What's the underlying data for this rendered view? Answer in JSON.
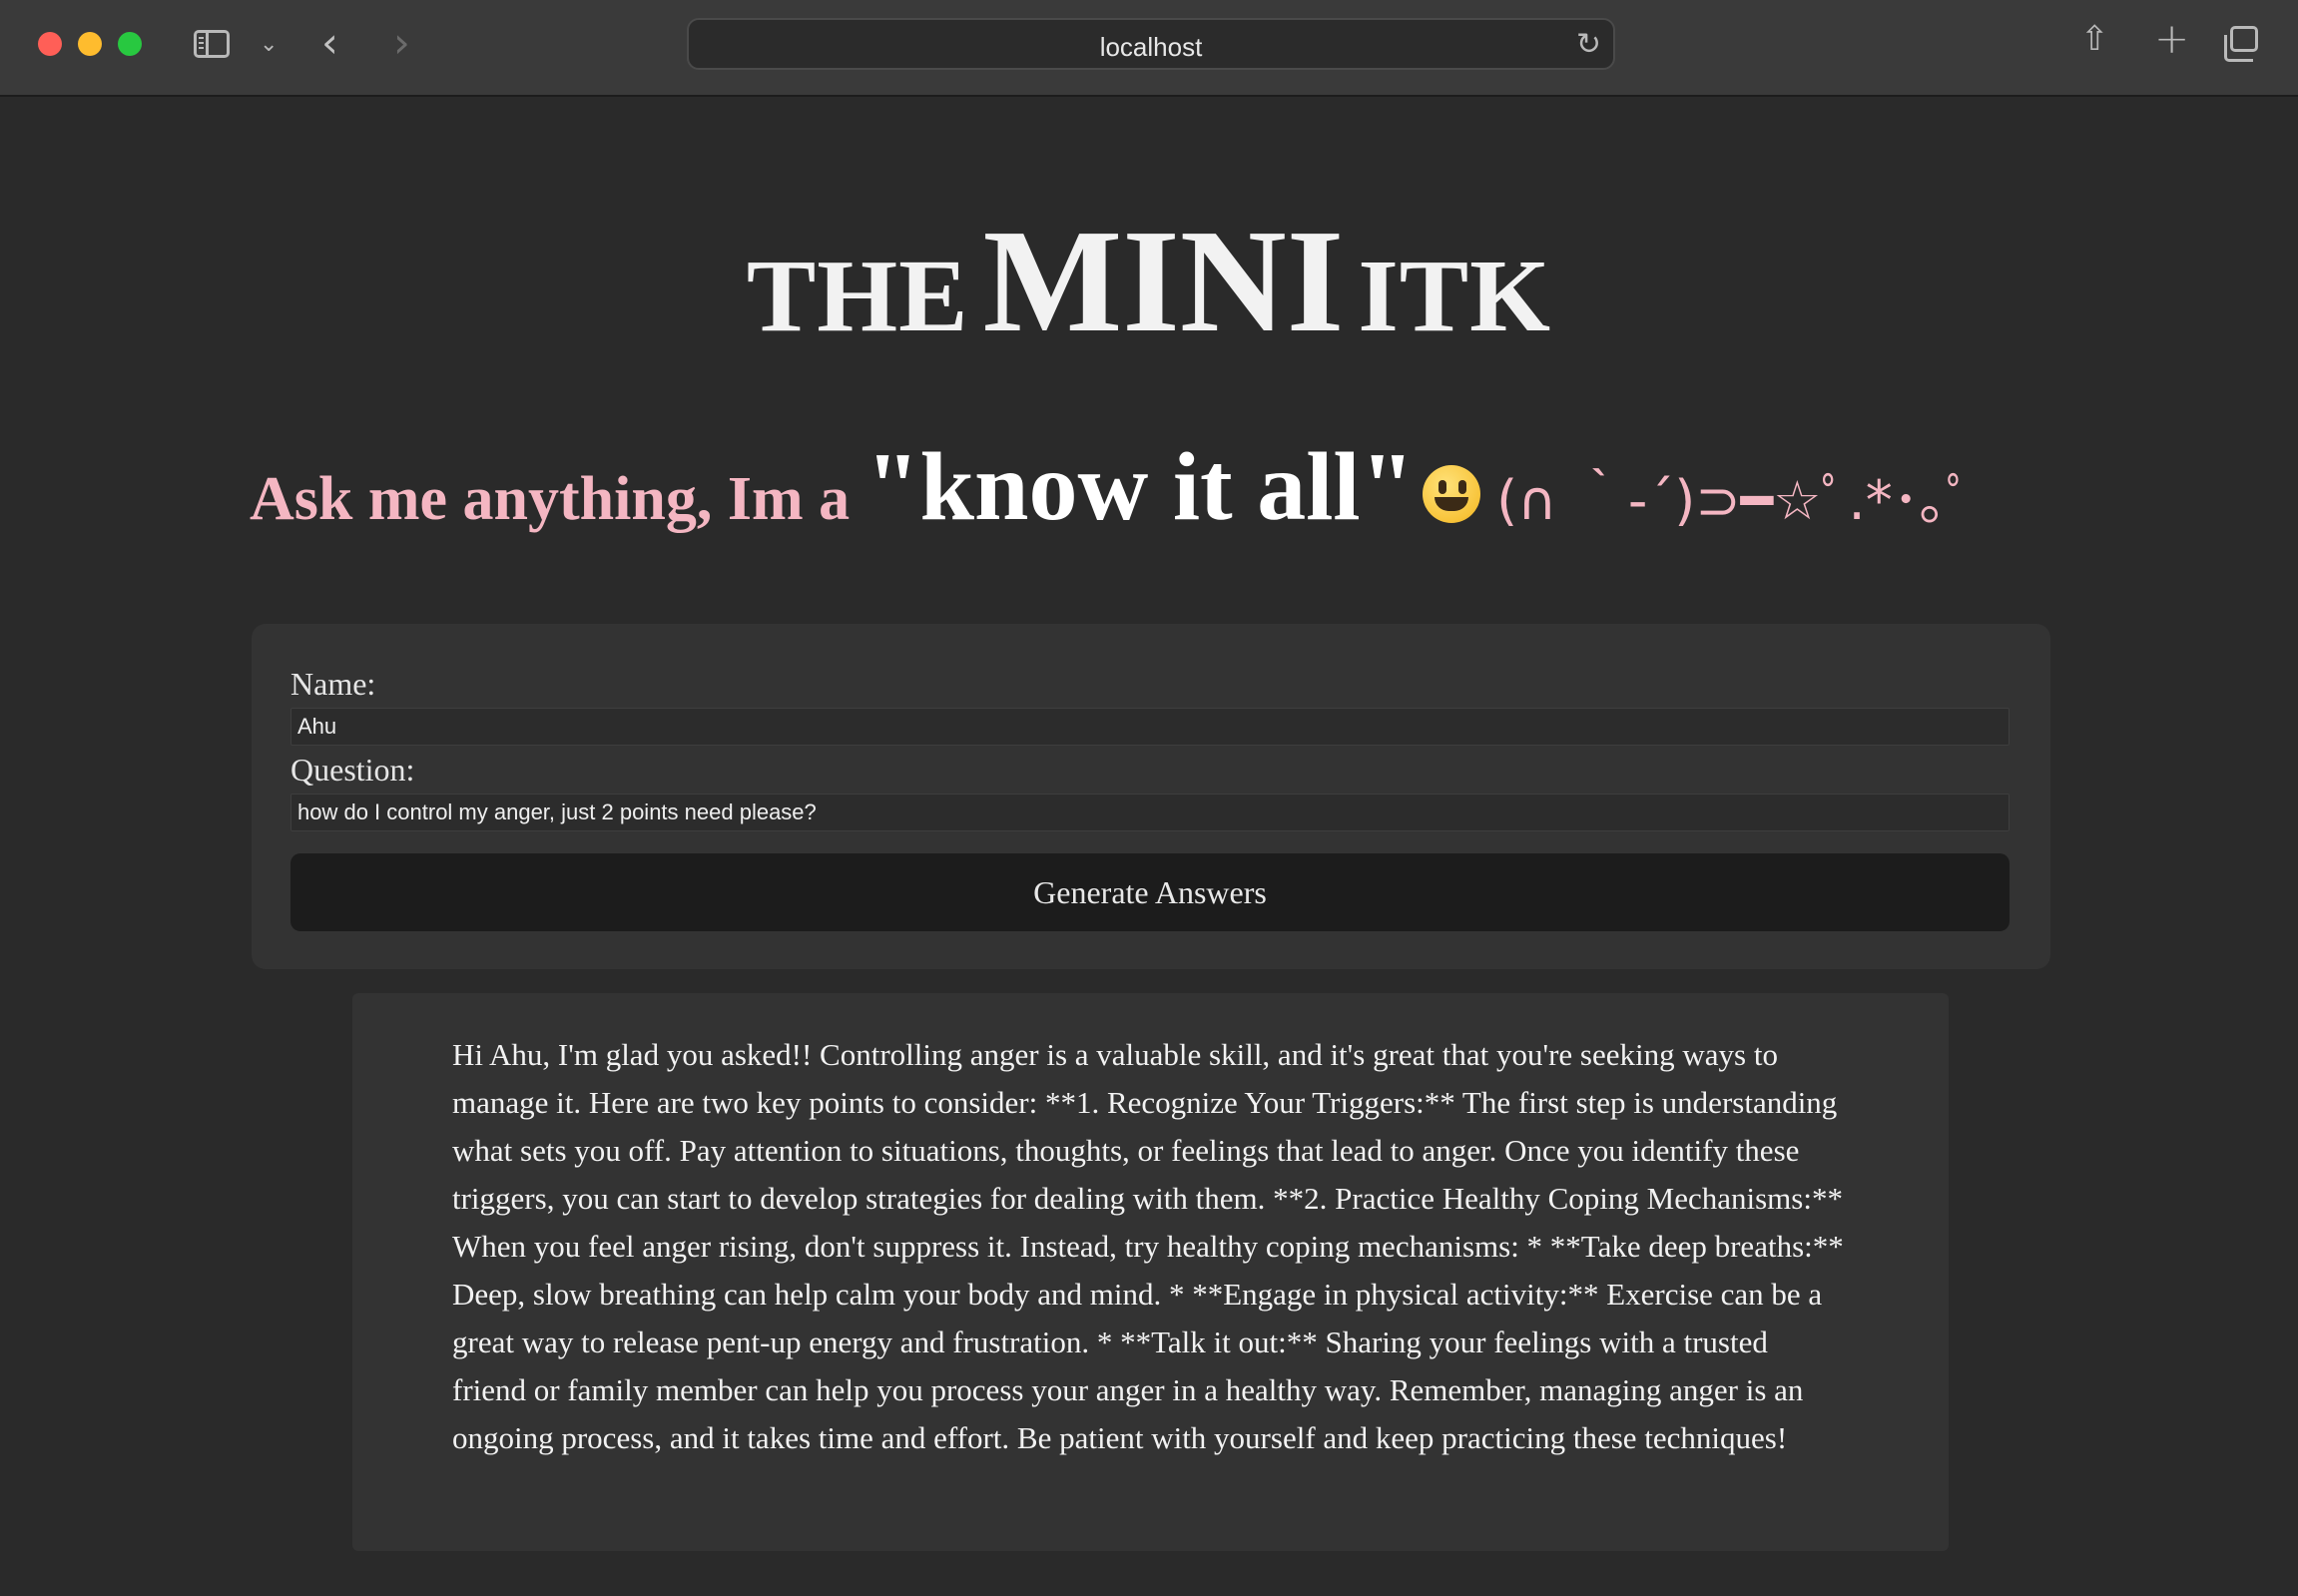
{
  "browser": {
    "url": "localhost"
  },
  "hero": {
    "title_pre": "THE",
    "title_main": "MINI",
    "title_post": "ITK"
  },
  "subtitle": {
    "lead": "Ask me anything, Im a",
    "quote": "\"know it all\"",
    "emoji_icon": "smiley-face-icon",
    "kaomoji": "(∩ ｀-´)⊃━☆ﾟ.*･｡ﾟ"
  },
  "form": {
    "name_label": "Name:",
    "name_value": "Ahu",
    "question_label": "Question:",
    "question_value": "how do I control my anger, just 2 points need please?",
    "submit_label": "Generate Answers"
  },
  "answer": {
    "text": "Hi Ahu, I'm glad you asked!! Controlling anger is a valuable skill, and it's great that you're seeking ways to manage it. Here are two key points to consider: **1. Recognize Your Triggers:** The first step is understanding what sets you off. Pay attention to situations, thoughts, or feelings that lead to anger. Once you identify these triggers, you can start to develop strategies for dealing with them. **2. Practice Healthy Coping Mechanisms:** When you feel anger rising, don't suppress it. Instead, try healthy coping mechanisms: * **Take deep breaths:** Deep, slow breathing can help calm your body and mind. * **Engage in physical activity:** Exercise can be a great way to release pent-up energy and frustration. * **Talk it out:** Sharing your feelings with a trusted friend or family member can help you process your anger in a healthy way. Remember, managing anger is an ongoing process, and it takes time and effort. Be patient with yourself and keep practicing these techniques!"
  },
  "colors": {
    "page_background": "#2a2a2a",
    "card_background": "#333333",
    "accent_pink": "#f4b6c2",
    "button_background": "#1c1c1c"
  }
}
